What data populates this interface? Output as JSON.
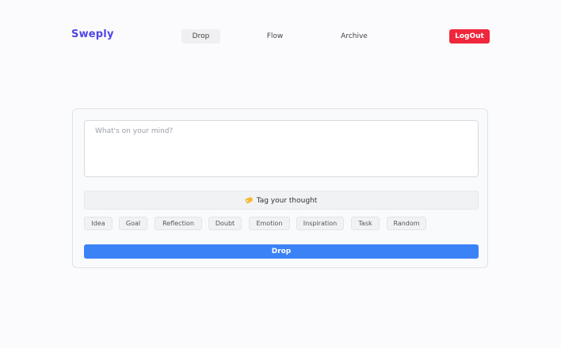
{
  "header": {
    "brand": "Sweply",
    "nav": [
      {
        "label": "Drop",
        "active": true
      },
      {
        "label": "Flow",
        "active": false
      },
      {
        "label": "Archive",
        "active": false
      }
    ],
    "logout_label": "LogOut"
  },
  "composer": {
    "placeholder": "What's on your mind?",
    "value": "",
    "tag_header": "Tag your thought",
    "tag_icon": "label-tag-icon",
    "tags": [
      "Idea",
      "Goal",
      "Reflection",
      "Doubt",
      "Emotion",
      "Inspiration",
      "Task",
      "Random"
    ],
    "drop_label": "Drop"
  },
  "colors": {
    "brand": "#4f46e5",
    "logout": "#f0263c",
    "primary": "#3b82f6",
    "background": "#fbfbfd"
  }
}
